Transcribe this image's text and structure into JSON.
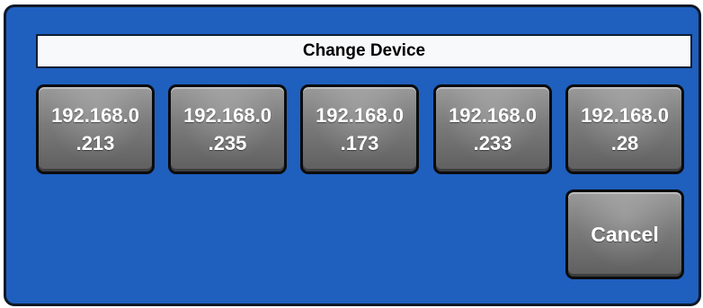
{
  "dialog": {
    "title": "Change Device",
    "devices": [
      {
        "line1": "192.168.0",
        "line2": ".213"
      },
      {
        "line1": "192.168.0",
        "line2": ".235"
      },
      {
        "line1": "192.168.0",
        "line2": ".173"
      },
      {
        "line1": "192.168.0",
        "line2": ".233"
      },
      {
        "line1": "192.168.0",
        "line2": ".28"
      }
    ],
    "cancel_label": "Cancel"
  },
  "colors": {
    "background": "#1f5fbe",
    "button": "#7a7a7a",
    "button_text": "#ffffff",
    "title_bg": "#f8f9fb"
  }
}
